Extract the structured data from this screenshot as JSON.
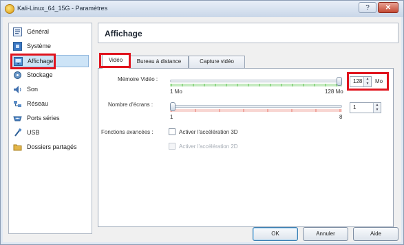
{
  "window": {
    "title": "Kali-Linux_64_15G - Paramètres",
    "help_glyph": "?",
    "close_glyph": "✕"
  },
  "sidebar": {
    "items": [
      {
        "label": "Général",
        "icon": "general-icon"
      },
      {
        "label": "Système",
        "icon": "system-icon"
      },
      {
        "label": "Affichage",
        "icon": "display-icon",
        "selected": true
      },
      {
        "label": "Stockage",
        "icon": "storage-icon"
      },
      {
        "label": "Son",
        "icon": "audio-icon"
      },
      {
        "label": "Réseau",
        "icon": "network-icon"
      },
      {
        "label": "Ports séries",
        "icon": "serial-ports-icon"
      },
      {
        "label": "USB",
        "icon": "usb-icon"
      },
      {
        "label": "Dossiers partagés",
        "icon": "shared-folders-icon"
      }
    ]
  },
  "main": {
    "section_title": "Affichage",
    "tabs": [
      {
        "label": "Vidéo",
        "active": true
      },
      {
        "label": "Bureau à distance"
      },
      {
        "label": "Capture vidéo"
      }
    ],
    "video_memory": {
      "label": "Mémoire Vidéo :",
      "min_label": "1 Mo",
      "max_label": "128 Mo",
      "value": "128",
      "unit": "Mo",
      "level": 1.0
    },
    "screens": {
      "label": "Nombre d'écrans :",
      "min_label": "1",
      "max_label": "8",
      "value": "1",
      "level": 0.0
    },
    "advanced": {
      "label": "Fonctions avancées :",
      "option_3d": "Activer l'accélération 3D",
      "option_2d": "Activer l'accélération 2D"
    }
  },
  "buttons": {
    "ok": "OK",
    "cancel": "Annuler",
    "help": "Aide"
  },
  "colors": {
    "highlight_box": "#e0131d",
    "selection": "#cde4f7",
    "tick_green": "#58c24a",
    "tick_red": "#e8766b"
  }
}
